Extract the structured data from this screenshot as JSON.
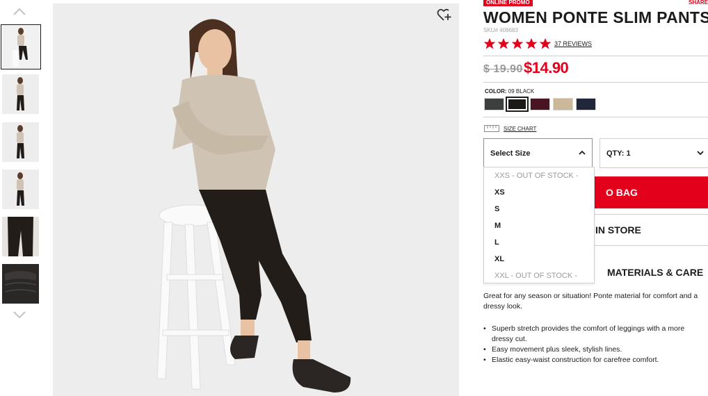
{
  "product": {
    "promo_badge": "ONLINE PROMO",
    "share_label": "SHARE",
    "title": "WOMEN PONTE SLIM PANTS",
    "sku": "SKU# 408683",
    "rating_stars": 5,
    "reviews_label": "37 REVIEWS",
    "old_price": "$ 19.90",
    "price": "$14.90",
    "color_label": "COLOR:",
    "color_value": "09 BLACK",
    "swatches": [
      {
        "name": "gray",
        "color": "#3c3f3d"
      },
      {
        "name": "black",
        "color": "#1c1a18"
      },
      {
        "name": "wine",
        "color": "#4a1523"
      },
      {
        "name": "beige",
        "color": "#c9b89a"
      },
      {
        "name": "navy",
        "color": "#1f2738"
      }
    ],
    "selected_swatch": 1,
    "size_chart_label": "SIZE CHART",
    "size_select_label": "Select Size",
    "qty_label": "QTY: 1",
    "size_options": [
      "XXS - OUT OF STOCK -",
      "XS",
      "S",
      "M",
      "L",
      "XL",
      "XXL - OUT OF STOCK -"
    ],
    "add_to_bag_label": "O BAG",
    "in_store_label": "IN STORE",
    "materials_label": "MATERIALS & CARE",
    "description": "Great for any season or situation! Ponte material for comfort and a dressy look.",
    "bullets": [
      "Superb stretch provides the comfort of leggings with a more dressy cut.",
      "Easy movement plus sleek, stylish lines.",
      "Elastic easy-waist construction for carefree comfort."
    ]
  },
  "colors": {
    "brand_red": "#e3001b",
    "star_red": "#e3001b",
    "image_bg": "#ededed"
  }
}
